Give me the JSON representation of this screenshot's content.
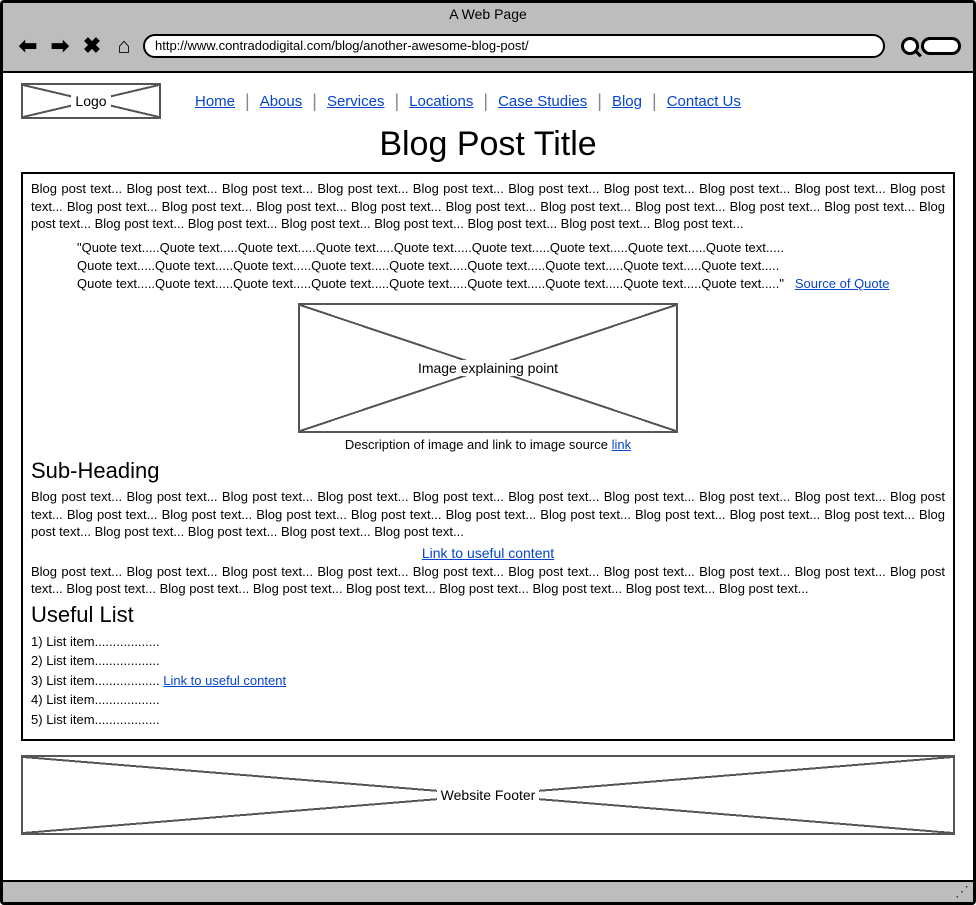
{
  "browser": {
    "title": "A Web Page",
    "url": "http://www.contradodigital.com/blog/another-awesome-blog-post/"
  },
  "header": {
    "logo_label": "Logo",
    "nav": [
      "Home",
      "Abous",
      "Services",
      "Locations",
      "Case Studies",
      "Blog",
      "Contact Us"
    ]
  },
  "post": {
    "title": "Blog Post Title",
    "para1": "Blog post text... Blog post text... Blog post text... Blog post text... Blog post text... Blog post text... Blog post text... Blog post text... Blog post text... Blog post text... Blog post text... Blog post text... Blog post text... Blog post text... Blog post text... Blog post text... Blog post text... Blog post text... Blog post text... Blog post text... Blog post text... Blog post text... Blog post text... Blog post text... Blog post text... Blog post text... Blog post text...",
    "quote_lines": [
      "\"Quote text.....Quote text.....Quote text.....Quote text.....Quote text.....Quote text.....Quote text.....Quote text.....Quote text.....",
      "Quote text.....Quote text.....Quote text.....Quote text.....Quote text.....Quote text.....Quote text.....Quote text.....Quote text.....",
      "Quote text.....Quote text.....Quote text.....Quote text.....Quote text.....Quote text.....Quote text.....Quote text.....Quote text.....\""
    ],
    "quote_source": "Source of Quote",
    "image_label": "Image explaining point",
    "image_caption_text": "Description of image and link to image source ",
    "image_caption_link": "link",
    "subheading": "Sub-Heading",
    "para2": "Blog post text... Blog post text... Blog post text... Blog post text... Blog post text... Blog post text... Blog post text... Blog post text... Blog post text... Blog post text... Blog post text... Blog post text... Blog post text... Blog post text... Blog post text... Blog post text... Blog post text... Blog post text... Blog post text... Blog post text... Blog post text... Blog post text... Blog post text... Blog post text...",
    "useful_link": "Link to useful content",
    "para3": "Blog post text... Blog post text... Blog post text... Blog post text... Blog post text... Blog post text... Blog post text... Blog post text... Blog post text... Blog post text... Blog post text... Blog post text... Blog post text... Blog post text... Blog post text... Blog post text... Blog post text... Blog post text...",
    "list_heading": "Useful List",
    "list_items": [
      {
        "n": "1)",
        "text": "List item..................",
        "link": ""
      },
      {
        "n": "2)",
        "text": "List item..................",
        "link": ""
      },
      {
        "n": "3)",
        "text": "List item.................. ",
        "link": "Link to useful content"
      },
      {
        "n": "4)",
        "text": "List item..................",
        "link": ""
      },
      {
        "n": "5)",
        "text": "List item..................",
        "link": ""
      }
    ]
  },
  "footer": {
    "label": "Website Footer"
  }
}
